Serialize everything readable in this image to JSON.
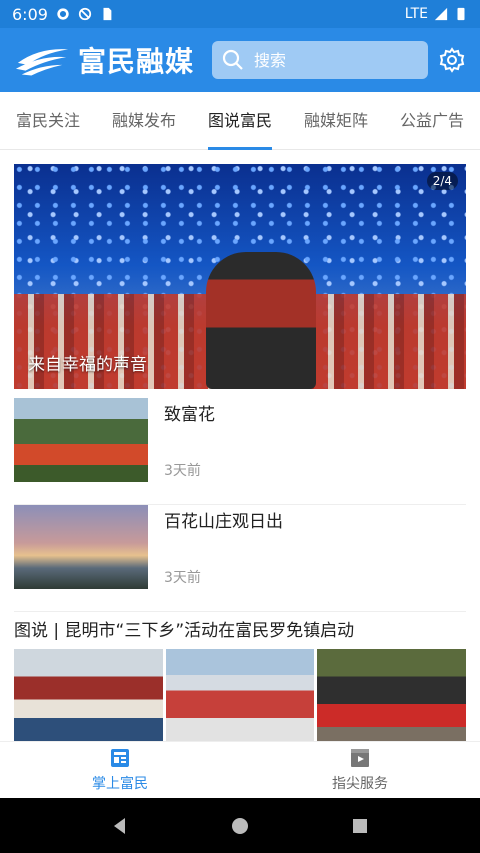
{
  "status_bar": {
    "time": "6:09",
    "network": "LTE"
  },
  "header": {
    "app_name": "富民融媒",
    "search_placeholder": "搜索"
  },
  "tabs": [
    {
      "label": "富民关注",
      "active": false
    },
    {
      "label": "融媒发布",
      "active": false
    },
    {
      "label": "图说富民",
      "active": true
    },
    {
      "label": "融媒矩阵",
      "active": false
    },
    {
      "label": "公益广告",
      "active": false
    }
  ],
  "carousel": {
    "caption": "来自幸福的声音",
    "counter": "2/4"
  },
  "news": [
    {
      "title": "致富花",
      "time": "3天前"
    },
    {
      "title": "百花山庄观日出",
      "time": "3天前"
    }
  ],
  "gallery": {
    "title": "图说 | 昆明市“三下乡”活动在富民罗免镇启动"
  },
  "bottom_nav": [
    {
      "label": "掌上富民",
      "active": true,
      "icon": "news-icon"
    },
    {
      "label": "指尖服务",
      "active": false,
      "icon": "video-icon"
    }
  ],
  "colors": {
    "primary": "#2a8ae6",
    "status_bar": "#1f7fd8"
  }
}
